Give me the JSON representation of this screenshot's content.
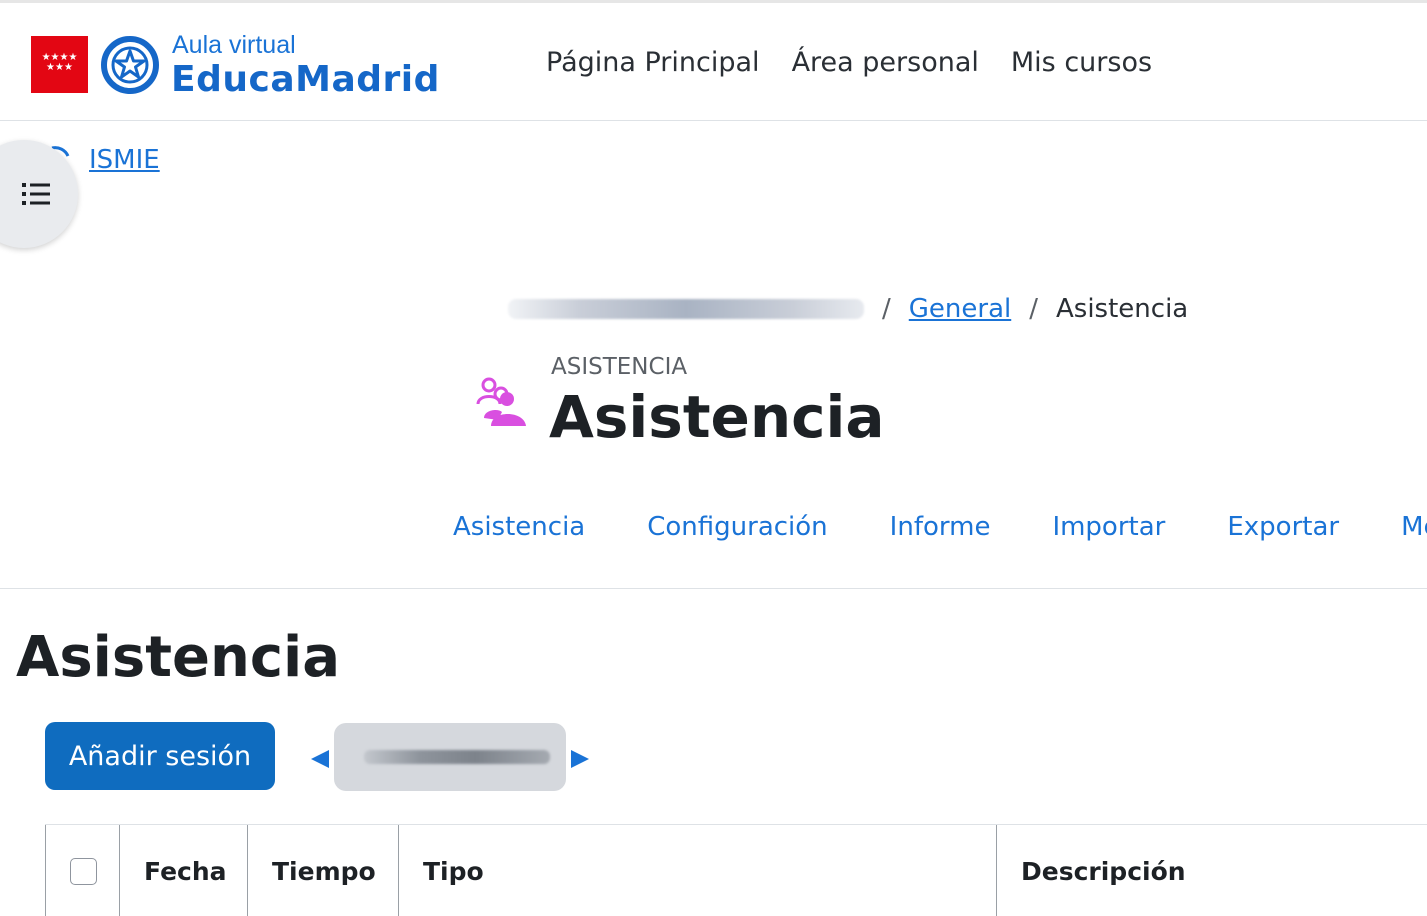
{
  "brand": {
    "flag_stars": "★★★★\n★★★",
    "small": "Aula virtual",
    "big": "EducaMadrid",
    "accent": "#1567c8",
    "flag_color": "#e30613"
  },
  "main_nav": [
    {
      "label": "Página Principal"
    },
    {
      "label": "Área personal"
    },
    {
      "label": "Mis cursos"
    }
  ],
  "course_index": {
    "icon": "list-icon",
    "course": "ISMIE"
  },
  "breadcrumb": {
    "items": [
      "General",
      "Asistencia"
    ],
    "separator": "/"
  },
  "header": {
    "module_label": "ASISTENCIA",
    "title": "Asistencia",
    "icon": "attendance-people-icon",
    "icon_color": "#d94fe0"
  },
  "secondary_nav": [
    {
      "label": "Asistencia"
    },
    {
      "label": "Configuración"
    },
    {
      "label": "Informe"
    },
    {
      "label": "Importar"
    },
    {
      "label": "Exportar"
    },
    {
      "label": "Mensaje"
    }
  ],
  "section": {
    "title": "Asistencia",
    "add_button": "Añadir sesión",
    "button_color": "#0f6cbf",
    "link_color": "#1a73d6"
  },
  "table": {
    "columns": [
      "Fecha",
      "Tiempo",
      "Tipo",
      "Descripción"
    ]
  }
}
